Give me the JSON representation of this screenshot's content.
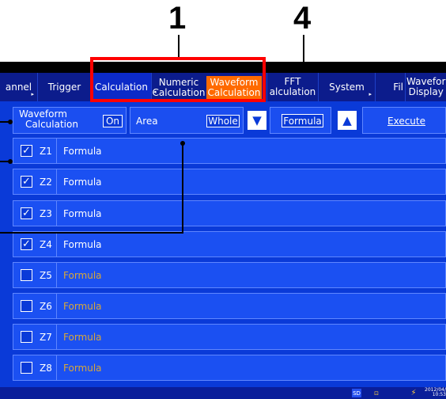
{
  "callouts": {
    "c1": "1",
    "c4": "4"
  },
  "tabs": {
    "channel": "annel",
    "trigger": "Trigger",
    "calculation": "Calculation",
    "numeric_line1": "Numeric",
    "numeric_line2": "Calculation",
    "waveform_line1": "Waveform",
    "waveform_line2": "Calculation",
    "fft_line1": "FFT",
    "fft_line2": "alculation",
    "system": "System",
    "file": "Fil",
    "waveform_display_line1": "Wavefor",
    "waveform_display_line2": "Display"
  },
  "toolbar": {
    "waveform_calc_line1": "Waveform",
    "waveform_calc_line2": "Calculation",
    "on_value": "On",
    "area_label": "Area",
    "area_value": "Whole",
    "formula_label": "Formula",
    "execute_label": "Execute"
  },
  "rows": [
    {
      "id": "Z1",
      "checked": true,
      "formula": "Formula"
    },
    {
      "id": "Z2",
      "checked": true,
      "formula": "Formula"
    },
    {
      "id": "Z3",
      "checked": true,
      "formula": "Formula"
    },
    {
      "id": "Z4",
      "checked": true,
      "formula": "Formula"
    },
    {
      "id": "Z5",
      "checked": false,
      "formula": "Formula"
    },
    {
      "id": "Z6",
      "checked": false,
      "formula": "Formula"
    },
    {
      "id": "Z7",
      "checked": false,
      "formula": "Formula"
    },
    {
      "id": "Z8",
      "checked": false,
      "formula": "Formula"
    }
  ],
  "status": {
    "sd": "SD",
    "date": "2012/04/",
    "time": "10:53"
  },
  "colors": {
    "enabled_text": "#ffffff",
    "disabled_text": "#d8a73a",
    "selected_tab": "#ff6a00"
  }
}
